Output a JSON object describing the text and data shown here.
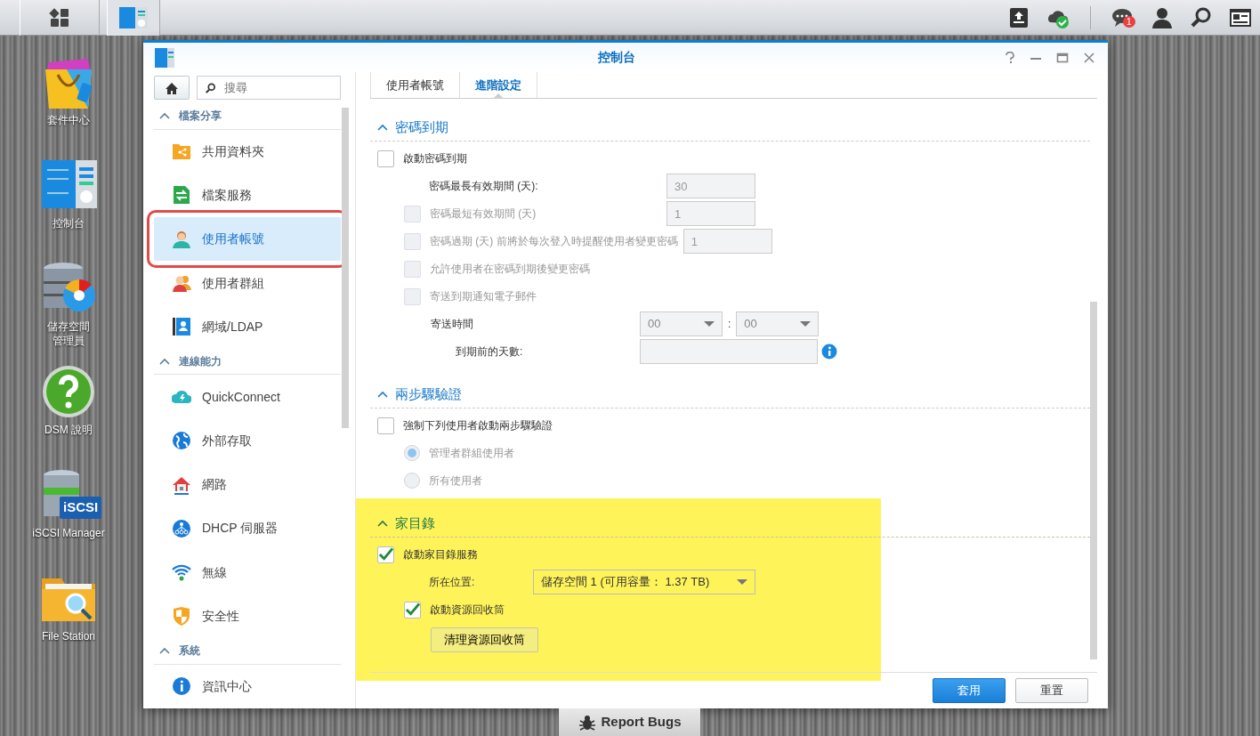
{
  "taskbar": {
    "notification_count": "1"
  },
  "desktop_icons": [
    {
      "lines": [
        "套件中心"
      ],
      "kind": "package"
    },
    {
      "lines": [
        "控制台"
      ],
      "kind": "control"
    },
    {
      "lines": [
        "儲存空間",
        "管理員"
      ],
      "kind": "storage"
    },
    {
      "lines": [
        "DSM 說明"
      ],
      "kind": "help"
    },
    {
      "lines": [
        "iSCSI Manager"
      ],
      "kind": "iscsi",
      "badge": "iSCSI"
    },
    {
      "lines": [
        "File Station"
      ],
      "kind": "files"
    }
  ],
  "window": {
    "title": "控制台"
  },
  "sidebar": {
    "search": {
      "placeholder": "搜尋"
    },
    "groups": [
      {
        "title": "檔案分享",
        "items": [
          {
            "label": "共用資料夾",
            "selected": false,
            "annotated": false
          },
          {
            "label": "檔案服務",
            "selected": false,
            "annotated": false
          },
          {
            "label": "使用者帳號",
            "selected": true,
            "annotated": true
          },
          {
            "label": "使用者群組",
            "selected": false,
            "annotated": false
          },
          {
            "label": "網域/LDAP",
            "selected": false,
            "annotated": false
          }
        ]
      },
      {
        "title": "連線能力",
        "items": [
          {
            "label": "QuickConnect",
            "selected": false,
            "annotated": false
          },
          {
            "label": "外部存取",
            "selected": false,
            "annotated": false
          },
          {
            "label": "網路",
            "selected": false,
            "annotated": false
          },
          {
            "label": "DHCP 伺服器",
            "selected": false,
            "annotated": false
          },
          {
            "label": "無線",
            "selected": false,
            "annotated": false
          },
          {
            "label": "安全性",
            "selected": false,
            "annotated": false
          }
        ]
      },
      {
        "title": "系統",
        "items": [
          {
            "label": "資訊中心",
            "selected": false,
            "annotated": false
          }
        ]
      }
    ]
  },
  "tabs": [
    {
      "label": "使用者帳號",
      "selected": false
    },
    {
      "label": "進階設定",
      "selected": true
    }
  ],
  "sections": [
    {
      "title": "密碼到期",
      "rows": [
        {
          "kind": "checkbox",
          "label": "啟動密碼到期",
          "checked": false,
          "disabled": false,
          "children": [
            {
              "kind": "field",
              "label": "密碼最長有效期間 (天):",
              "value": "30",
              "disabled": true
            },
            {
              "kind": "checkbox-field",
              "label": "密碼最短有效期間 (天)",
              "checked": false,
              "disabled": true,
              "value": "1"
            },
            {
              "kind": "checkbox-field",
              "label": "密碼過期 (天) 前將於每次登入時提醒使用者變更密碼",
              "checked": false,
              "disabled": true,
              "value": "1"
            },
            {
              "kind": "checkbox",
              "label": "允許使用者在密碼到期後變更密碼",
              "checked": false,
              "disabled": true
            },
            {
              "kind": "checkbox",
              "label": "寄送到期通知電子郵件",
              "checked": false,
              "disabled": true,
              "children": [
                {
                  "kind": "time",
                  "label": "寄送時間",
                  "hour": "00",
                  "separator": ":",
                  "minute": "00",
                  "disabled": true
                },
                {
                  "kind": "field",
                  "label": "到期前的天數:",
                  "disabled": true,
                  "info": true
                }
              ]
            }
          ]
        }
      ]
    },
    {
      "title": "兩步驟驗證",
      "rows": [
        {
          "kind": "checkbox",
          "label": "強制下列使用者啟動兩步驟驗證",
          "checked": false,
          "disabled": false,
          "children": [
            {
              "kind": "radio",
              "label": "管理者群組使用者",
              "selected": true,
              "disabled": true
            },
            {
              "kind": "radio",
              "label": "所有使用者",
              "selected": false,
              "disabled": true
            }
          ]
        }
      ]
    },
    {
      "title": "家目錄",
      "highlighted": true,
      "rows": [
        {
          "kind": "checkbox",
          "label": "啟動家目錄服務",
          "checked": true,
          "disabled": false,
          "children": [
            {
              "kind": "select",
              "label": "所在位置:",
              "value": "儲存空間 1 (可用容量： 1.37 TB)",
              "disabled": false
            },
            {
              "kind": "checkbox",
              "label": "啟動資源回收筒",
              "checked": true,
              "disabled": false,
              "children": [
                {
                  "kind": "button",
                  "label": "清理資源回收筒",
                  "disabled": false
                }
              ]
            }
          ]
        }
      ]
    }
  ],
  "footer_buttons": [
    {
      "label": "套用",
      "primary": true
    },
    {
      "label": "重置",
      "primary": false
    }
  ],
  "report_bugs": "Report Bugs"
}
